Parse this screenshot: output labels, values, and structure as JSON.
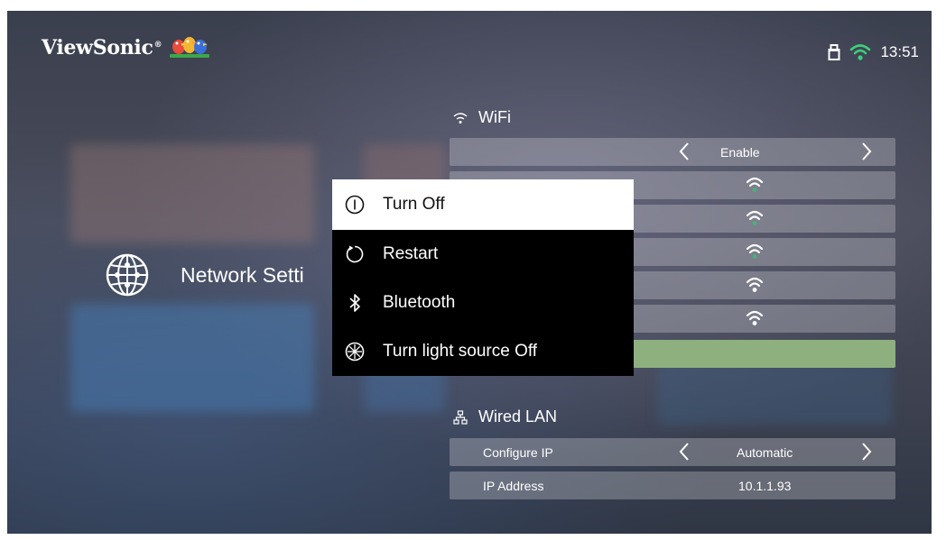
{
  "brand": {
    "name": "ViewSonic",
    "registered": "®"
  },
  "status": {
    "time": "13:51",
    "icons": [
      "usb-icon",
      "wifi-icon"
    ]
  },
  "page": {
    "title": "Network Setti",
    "icon": "globe-icon"
  },
  "wifi": {
    "heading": "WiFi",
    "toggle": {
      "value": "Enable"
    },
    "networks": [
      "wifi-signal-green",
      "wifi-signal-green",
      "wifi-signal-green",
      "wifi-signal-white",
      "wifi-signal-white"
    ]
  },
  "wired": {
    "heading": "Wired LAN",
    "rows": [
      {
        "label": "Configure IP",
        "value": "Automatic"
      },
      {
        "label": "IP Address",
        "value": "10.1.1.93"
      }
    ]
  },
  "power_menu": {
    "items": [
      {
        "label": "Turn Off",
        "icon": "power-icon"
      },
      {
        "label": "Restart",
        "icon": "restart-icon"
      },
      {
        "label": "Bluetooth",
        "icon": "bluetooth-icon"
      },
      {
        "label": "Turn light source Off",
        "icon": "light-off-icon"
      }
    ],
    "selected": "Turn Off"
  },
  "colors": {
    "accent_green": "#4caf7a",
    "selected_bg": "#ffffff",
    "menu_bg": "#000000"
  }
}
